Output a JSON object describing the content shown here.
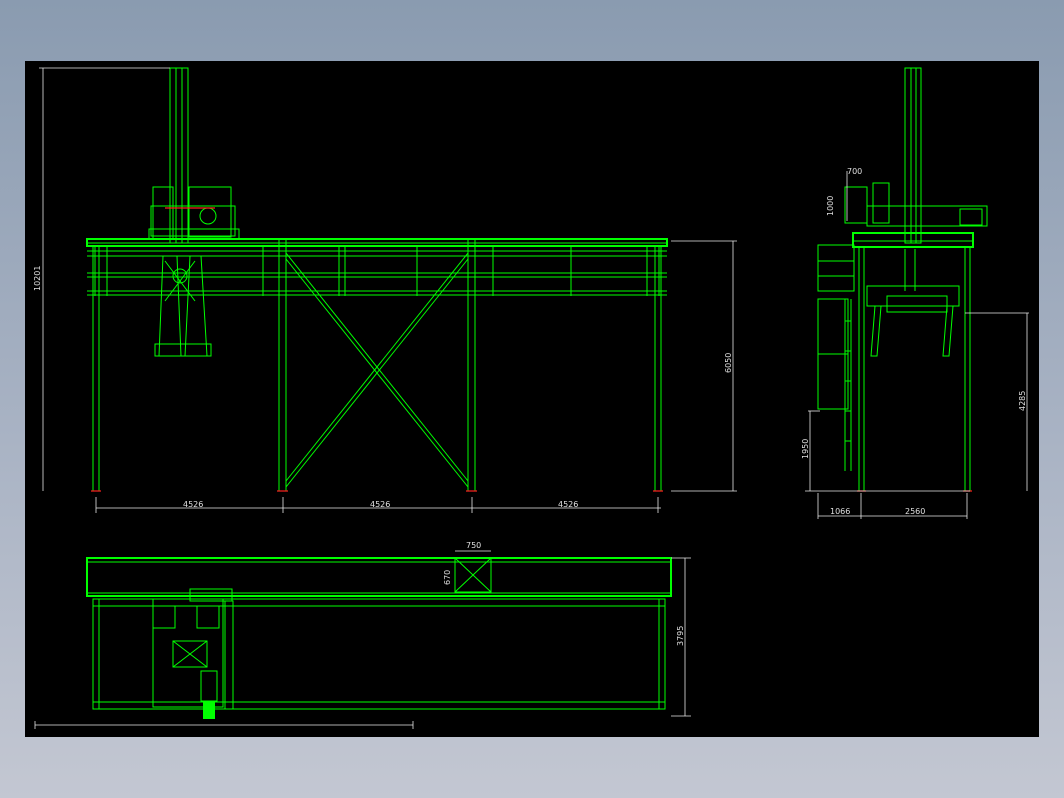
{
  "colors": {
    "background": "#000000",
    "line": "#00ff00",
    "dimension": "#e8e8e8",
    "marker": "#ff2020",
    "window": "#9aa6b8"
  },
  "front_view": {
    "total_height": "10201",
    "span_1": "4526",
    "span_2": "4526",
    "span_3": "4526",
    "beam_height": "6050"
  },
  "side_view": {
    "motor_width": "700",
    "motor_height": "1000",
    "gripper_height": "4285",
    "ladder_height": "1950",
    "ladder_offset": "1066",
    "rail_gauge": "2560"
  },
  "top_view": {
    "box_width": "750",
    "box_height": "670",
    "frame_depth": "3795"
  }
}
